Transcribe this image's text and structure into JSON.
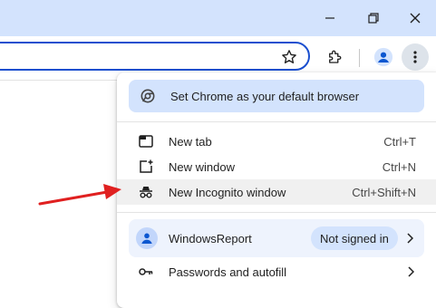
{
  "window": {
    "controls": {
      "minimize_icon": "minimize-icon",
      "restore_icon": "restore-icon",
      "close_icon": "close-icon"
    }
  },
  "toolbar": {
    "icons": [
      "bookmark-star-icon",
      "extensions-icon",
      "profile-icon",
      "more-menu-icon"
    ],
    "accent_color": "#1a4fcf"
  },
  "menu": {
    "default_browser_banner": "Set Chrome as your default browser",
    "items": [
      {
        "label": "New tab",
        "shortcut": "Ctrl+T",
        "icon": "new-tab-icon"
      },
      {
        "label": "New window",
        "shortcut": "Ctrl+N",
        "icon": "new-window-icon"
      },
      {
        "label": "New Incognito window",
        "shortcut": "Ctrl+Shift+N",
        "icon": "incognito-icon",
        "highlighted": true
      }
    ],
    "profile": {
      "name": "WindowsReport",
      "status": "Not signed in"
    },
    "passwords": {
      "label": "Passwords and autofill"
    }
  },
  "colors": {
    "titlebar": "#d3e3fd",
    "banner": "#d3e3fd",
    "profile_bg": "#eef3fd",
    "annotation_arrow": "#e02020"
  }
}
